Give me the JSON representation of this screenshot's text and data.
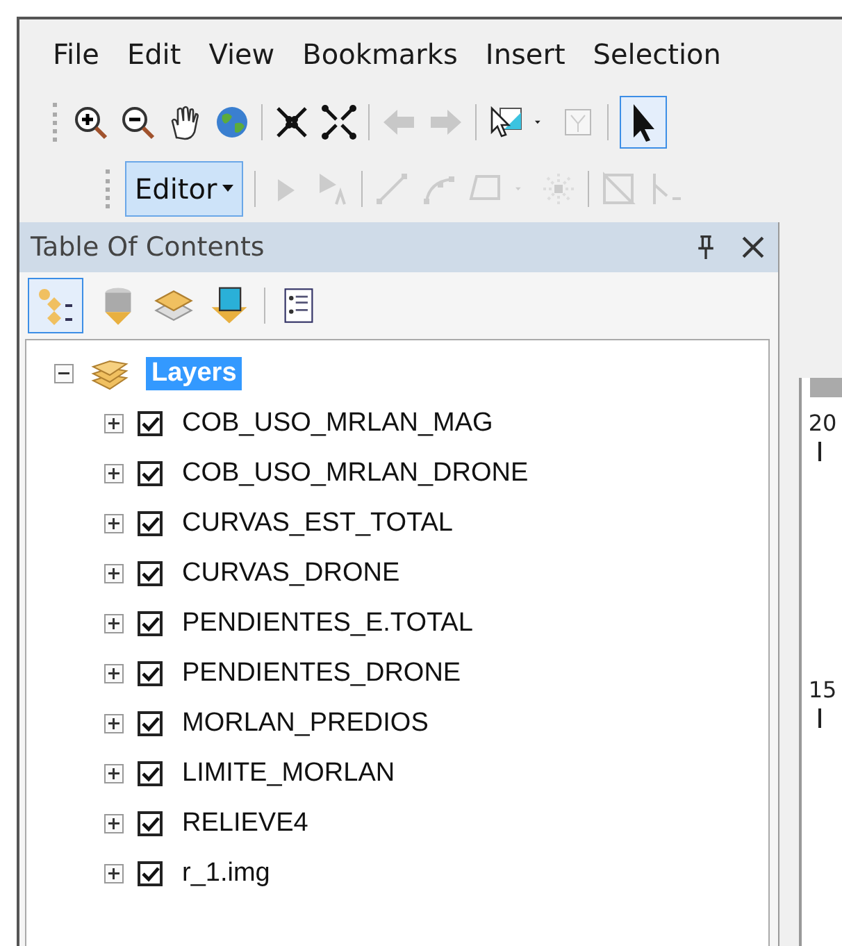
{
  "menu": [
    "File",
    "Edit",
    "View",
    "Bookmarks",
    "Insert",
    "Selection"
  ],
  "editor_toolbar": {
    "label": "Editor"
  },
  "toc": {
    "title": "Table Of Contents",
    "root": {
      "label": "Layers",
      "expanded": true,
      "selected": true,
      "children": [
        {
          "label": "COB_USO_MRLAN_MAG",
          "checked": true,
          "expanded": false
        },
        {
          "label": "COB_USO_MRLAN_DRONE",
          "checked": true,
          "expanded": false
        },
        {
          "label": "CURVAS_EST_TOTAL",
          "checked": true,
          "expanded": false
        },
        {
          "label": "CURVAS_DRONE",
          "checked": true,
          "expanded": false
        },
        {
          "label": "PENDIENTES_E.TOTAL",
          "checked": true,
          "expanded": false
        },
        {
          "label": "PENDIENTES_DRONE",
          "checked": true,
          "expanded": false
        },
        {
          "label": "MORLAN_PREDIOS",
          "checked": true,
          "expanded": false
        },
        {
          "label": "LIMITE_MORLAN",
          "checked": true,
          "expanded": false
        },
        {
          "label": "RELIEVE4",
          "checked": true,
          "expanded": false
        },
        {
          "label": "r_1.img",
          "checked": true,
          "expanded": false
        }
      ]
    }
  },
  "ruler": {
    "labels": [
      "20",
      "15"
    ]
  }
}
